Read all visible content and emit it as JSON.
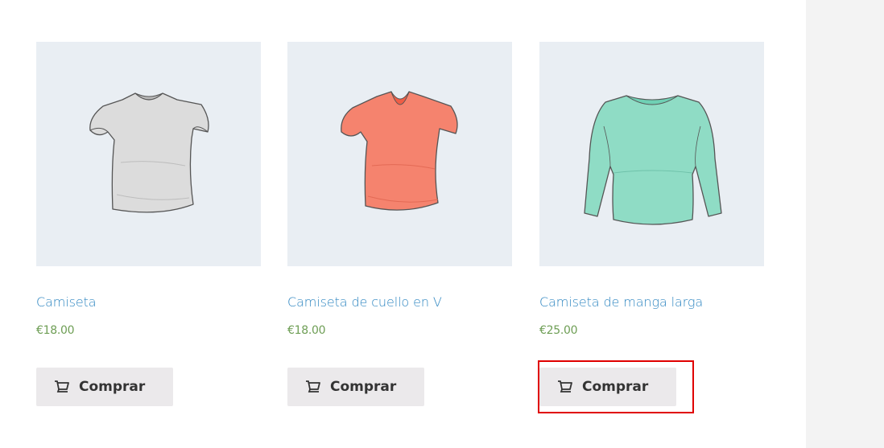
{
  "products": [
    {
      "title": "Camiseta",
      "price": "€18.00",
      "button_label": "Comprar",
      "image_icon": "white-tshirt",
      "color": "#d9d9d9"
    },
    {
      "title": "Camiseta de cuello en V",
      "price": "€18.00",
      "button_label": "Comprar",
      "image_icon": "coral-vneck-tshirt",
      "color": "#f5836e"
    },
    {
      "title": "Camiseta de manga larga",
      "price": "€25.00",
      "button_label": "Comprar",
      "image_icon": "mint-long-sleeve-shirt",
      "color": "#8fdcc5"
    }
  ],
  "icons": {
    "cart": "cart-icon"
  },
  "colors": {
    "link": "#2e86c1",
    "price": "#6e9e55",
    "button_bg": "#ebe9eb",
    "image_bg": "#e9eef3",
    "sidebar_bg": "#f3f3f3",
    "highlight": "#e00000"
  }
}
